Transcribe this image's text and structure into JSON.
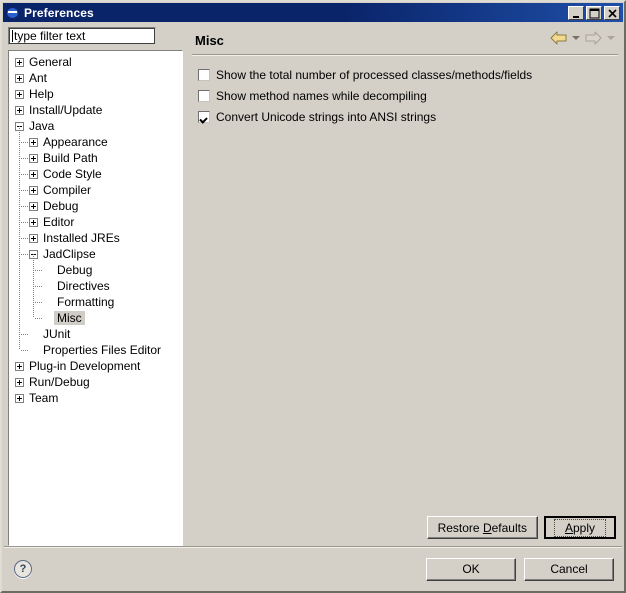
{
  "window": {
    "title": "Preferences",
    "icon": "eclipse-globe-icon",
    "buttons": {
      "minimize": "minimize-icon",
      "maximize": "maximize-icon",
      "close": "close-icon"
    }
  },
  "filter": {
    "value": "type filter text",
    "placeholder": "type filter text"
  },
  "tree": {
    "selected": "Misc",
    "items": [
      {
        "label": "General",
        "level": 0,
        "state": "collapsed"
      },
      {
        "label": "Ant",
        "level": 0,
        "state": "collapsed"
      },
      {
        "label": "Help",
        "level": 0,
        "state": "collapsed"
      },
      {
        "label": "Install/Update",
        "level": 0,
        "state": "collapsed"
      },
      {
        "label": "Java",
        "level": 0,
        "state": "expanded"
      },
      {
        "label": "Appearance",
        "level": 1,
        "state": "collapsed"
      },
      {
        "label": "Build Path",
        "level": 1,
        "state": "collapsed"
      },
      {
        "label": "Code Style",
        "level": 1,
        "state": "collapsed"
      },
      {
        "label": "Compiler",
        "level": 1,
        "state": "collapsed"
      },
      {
        "label": "Debug",
        "level": 1,
        "state": "collapsed"
      },
      {
        "label": "Editor",
        "level": 1,
        "state": "collapsed"
      },
      {
        "label": "Installed JREs",
        "level": 1,
        "state": "collapsed"
      },
      {
        "label": "JadClipse",
        "level": 1,
        "state": "expanded"
      },
      {
        "label": "Debug",
        "level": 2,
        "state": "leaf"
      },
      {
        "label": "Directives",
        "level": 2,
        "state": "leaf"
      },
      {
        "label": "Formatting",
        "level": 2,
        "state": "leaf"
      },
      {
        "label": "Misc",
        "level": 2,
        "state": "leaf",
        "selected": true
      },
      {
        "label": "JUnit",
        "level": 1,
        "state": "leaf"
      },
      {
        "label": "Properties Files Editor",
        "level": 1,
        "state": "leaf"
      },
      {
        "label": "Plug-in Development",
        "level": 0,
        "state": "collapsed"
      },
      {
        "label": "Run/Debug",
        "level": 0,
        "state": "collapsed"
      },
      {
        "label": "Team",
        "level": 0,
        "state": "collapsed"
      }
    ]
  },
  "page": {
    "title": "Misc",
    "nav": {
      "back": {
        "name": "back-arrow-icon",
        "enabled": true,
        "color": "#f2d98a"
      },
      "back_menu": {
        "name": "back-dropdown-icon",
        "enabled": true
      },
      "forward": {
        "name": "forward-arrow-icon",
        "enabled": false,
        "color": "#cfcabf"
      },
      "forward_menu": {
        "name": "forward-dropdown-icon",
        "enabled": false
      }
    },
    "checkboxes": [
      {
        "label": "Show the total number of processed classes/methods/fields",
        "checked": false
      },
      {
        "label": "Show method names while decompiling",
        "checked": false
      },
      {
        "label": "Convert Unicode strings into ANSI strings",
        "checked": true
      }
    ],
    "buttons": {
      "restore_defaults": "Restore Defaults",
      "restore_defaults_mnemonic": "D",
      "apply": "Apply",
      "apply_mnemonic": "A"
    }
  },
  "footer": {
    "help": "?",
    "ok": "OK",
    "cancel": "Cancel"
  }
}
